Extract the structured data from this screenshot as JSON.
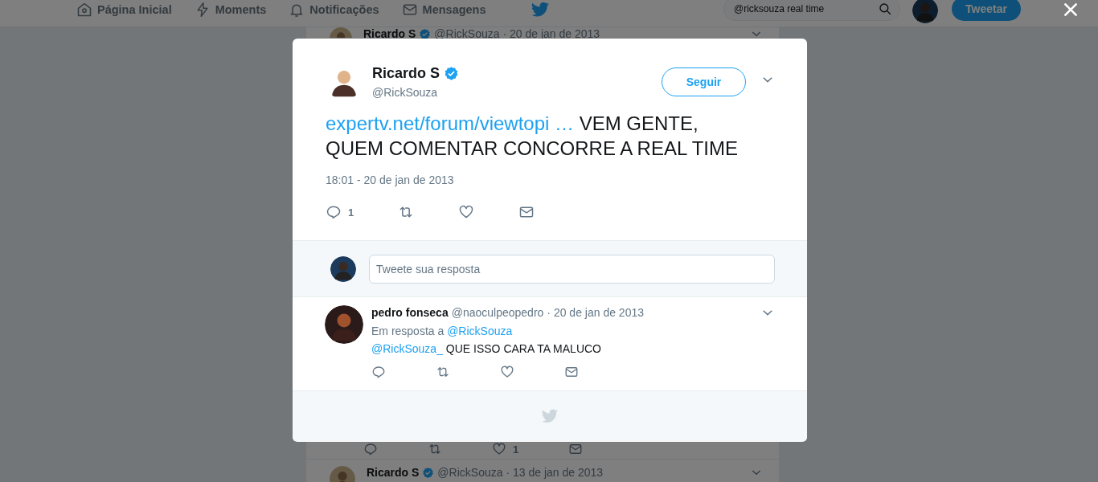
{
  "header": {
    "nav": [
      {
        "kind": "home",
        "label": "Página Inicial"
      },
      {
        "kind": "moments",
        "label": "Moments"
      },
      {
        "kind": "notifications",
        "label": "Notificações"
      },
      {
        "kind": "messages",
        "label": "Mensagens"
      }
    ],
    "search": {
      "value": "@ricksouza real time"
    },
    "tweet_button": "Tweetar"
  },
  "timeline": {
    "top_tweet": {
      "name": "Ricardo S",
      "verified": true,
      "handle": "@RickSouza",
      "date": "· 20 de jan de 2013"
    },
    "bottom_actions": [
      {
        "kind": "reply"
      },
      {
        "kind": "retweet"
      },
      {
        "kind": "like",
        "count": "1"
      },
      {
        "kind": "message"
      }
    ],
    "bottom_tweet": {
      "name": "Ricardo S",
      "verified": true,
      "handle": "@RickSouza",
      "date": "· 13 de jan de 2013"
    }
  },
  "modal": {
    "tweet": {
      "name": "Ricardo S",
      "verified": true,
      "handle": "@RickSouza",
      "follow_button": "Seguir",
      "link": "expertv.net/forum/viewtopi …",
      "text": "VEM GENTE, QUEM COMENTAR CONCORRE A REAL TIME",
      "timestamp": "18:01 - 20 de jan de 2013",
      "actions": [
        {
          "kind": "reply",
          "count": "1"
        },
        {
          "kind": "retweet"
        },
        {
          "kind": "like"
        },
        {
          "kind": "message"
        }
      ]
    },
    "reply_box": {
      "placeholder": "Tweete sua resposta"
    },
    "replies": [
      {
        "name": "pedro fonseca",
        "handle": "@naoculpeopedro",
        "date": "· 20 de jan de 2013",
        "reply_label": "Em resposta a",
        "reply_to": "@RickSouza",
        "mention": "@RickSouza_",
        "text": "QUE ISSO CARA TA MALUCO",
        "actions": [
          {
            "kind": "reply"
          },
          {
            "kind": "retweet"
          },
          {
            "kind": "like"
          },
          {
            "kind": "message"
          }
        ]
      }
    ]
  }
}
